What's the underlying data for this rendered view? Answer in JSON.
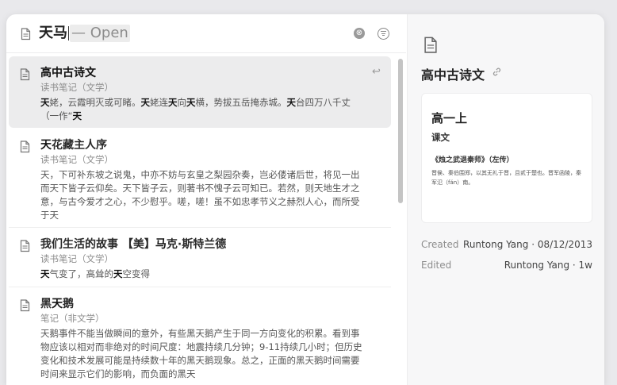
{
  "search": {
    "query": "天马",
    "suggestion": "— Open"
  },
  "results": [
    {
      "title_parts": [
        [
          "b",
          "高中古诗文"
        ]
      ],
      "category": "读书笔记（文学）",
      "snippet_parts": [
        [
          "b",
          "天"
        ],
        [
          "t",
          "姥，云霞明灭或可睹。"
        ],
        [
          "b",
          "天"
        ],
        [
          "t",
          "姥连"
        ],
        [
          "b",
          "天"
        ],
        [
          "t",
          "向"
        ],
        [
          "b",
          "天"
        ],
        [
          "t",
          "横，势拔五岳掩赤城。"
        ],
        [
          "b",
          "天"
        ],
        [
          "t",
          "台四万八千丈（一作“"
        ],
        [
          "b",
          "天"
        ]
      ]
    },
    {
      "title_parts": [
        [
          "b",
          "天"
        ],
        [
          "t",
          "花藏主人序"
        ]
      ],
      "category": "读书笔记（文学）",
      "snippet_parts": [
        [
          "t",
          "天，下可补东坡之说鬼，中亦不妨与玄皇之梨园杂奏，岂必偻诸后世，将见一出而天下皆子云仰矣。天下皆子云，则著书不愧子云可知已。若然，则天地生才之意，与古今爱才之心，不少慰乎。嗟，嗟！虽不如忠孝节义之赫烈人心，而所受于天"
        ]
      ]
    },
    {
      "title_parts": [
        [
          "t",
          "我们生活的故事 【美】"
        ],
        [
          "b",
          "马"
        ],
        [
          "t",
          "克·斯特兰德"
        ]
      ],
      "category": "读书笔记（文学）",
      "snippet_parts": [
        [
          "b",
          "天"
        ],
        [
          "t",
          "气变了，高耸的"
        ],
        [
          "b",
          "天"
        ],
        [
          "t",
          "空变得"
        ]
      ]
    },
    {
      "title_parts": [
        [
          "t",
          "黑"
        ],
        [
          "b",
          "天"
        ],
        [
          "t",
          "鹅"
        ]
      ],
      "category": "笔记（非文学）",
      "snippet_parts": [
        [
          "t",
          "天鹅事件不能当做瞬间的意外，有些黑天鹅产生于同一方向变化的积累。看到事物应该以相对而非绝对的时间尺度：地震持续几分钟；9-11持续几小时；但历史变化和技术发展可能是持续数十年的黑天鹅现象。总之，正面的黑天鹅时间需要时间来显示它们的影响，而负面的黑天"
        ]
      ]
    }
  ],
  "preview": {
    "title": "高中古诗文",
    "card": {
      "heading": "高一上",
      "subheading": "课文",
      "section": "《烛之武退秦师》（左传）",
      "body": "晋侯、秦伯围郑，以其无礼于晋，且贰于楚也。晋军函陵，秦军氾（fán）南。"
    },
    "created_label": "Created",
    "created_value": "Runtong Yang · 08/12/2013",
    "edited_label": "Edited",
    "edited_value": "Runtong Yang · 1w"
  },
  "icons": {
    "clear": "⊗",
    "enter": "↩",
    "link": "🔗"
  }
}
